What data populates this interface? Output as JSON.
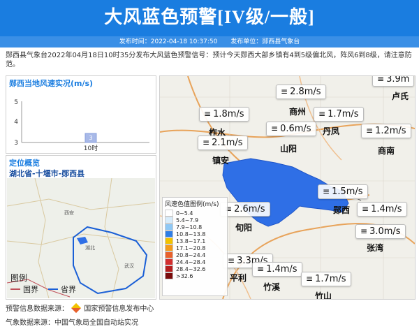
{
  "header": {
    "title": "大风蓝色预警[IV级/一般]",
    "publish_time": "发布时间：2022-04-18 10:37:50",
    "publisher": "发布单位：郧西县气象台"
  },
  "notice_text": "郧西县气象台2022年04月18日10时35分发布大风蓝色预警信号：预计今天郧西大部乡镇有4到5级偏北风，阵风6到8级，请注意防范。",
  "wind_panel": {
    "title": "郧西当地风速实况(m/s)",
    "y_ticks": [
      "5",
      "4",
      "3"
    ],
    "bar_value_label": "3",
    "x_label": "10时"
  },
  "chart_data": {
    "type": "bar",
    "title": "郧西当地风速实况(m/s)",
    "categories": [
      "10时"
    ],
    "values": [
      3
    ],
    "ylim": [
      3,
      5
    ]
  },
  "location_panel": {
    "title": "定位概览",
    "path": "湖北省-十堰市-郧西县",
    "legend_title": "图例",
    "legend_items": [
      {
        "label": "国界",
        "color": "#c0505a"
      },
      {
        "label": "省界",
        "color": "#1a5fd6"
      }
    ],
    "places": [
      "西安",
      "湖北",
      "武汉"
    ]
  },
  "map": {
    "places": [
      "商州",
      "丹凤",
      "柞水",
      "山阳",
      "镇安",
      "商南",
      "郧西",
      "旬阳",
      "张湾",
      "平利",
      "竹溪",
      "竹山",
      "卢氏"
    ],
    "wind_readings": [
      "2.8m/s",
      "1.8m/s",
      "1.7m/s",
      "0.6m/s",
      "1.2m/s",
      "2.1m/s",
      "1.5m/s",
      "2.6m/s",
      "1.4m/s",
      "3.0m/s",
      "3.3m/s",
      "1.4m/s",
      "1.7m/s",
      "3.9m"
    ]
  },
  "wind_legend": {
    "title": "风速色值图例(m/s)",
    "items": [
      {
        "label": "0~5.4",
        "color": "#ffffff"
      },
      {
        "label": "5.4~7.9",
        "color": "#d7ecfb"
      },
      {
        "label": "7.9~10.8",
        "color": "#8ec8f5"
      },
      {
        "label": "10.8~13.8",
        "color": "#2f7ee6"
      },
      {
        "label": "13.8~17.1",
        "color": "#f2c200"
      },
      {
        "label": "17.1~20.8",
        "color": "#f39a1b"
      },
      {
        "label": "20.8~24.4",
        "color": "#e8612c"
      },
      {
        "label": "24.4~28.4",
        "color": "#d32f2f"
      },
      {
        "label": "28.4~32.6",
        "color": "#b51e1e"
      },
      {
        "label": ">32.6",
        "color": "#7a0c0c"
      }
    ]
  },
  "footer": {
    "warning_source_prefix": "预警信息数据来源：",
    "warning_source": "国家预警信息发布中心",
    "weather_source": "气象数据来源：中国气象局全国自动站实况"
  },
  "colors": {
    "banner": "#1a7de0",
    "accent": "#1a7de0",
    "highlight_region": "#2f6fe6"
  }
}
